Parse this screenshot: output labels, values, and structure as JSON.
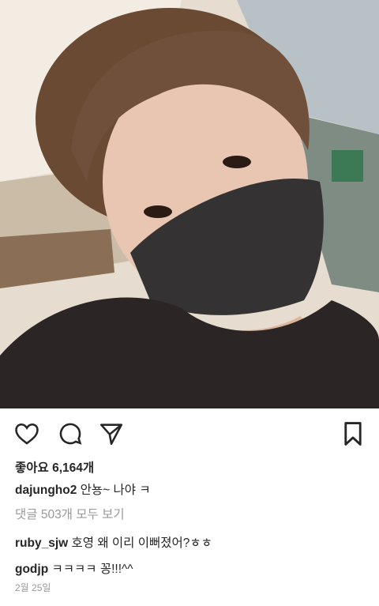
{
  "post": {
    "likes_text": "좋아요 6,164개",
    "caption": {
      "username": "dajungho2",
      "text": "안뇽~ 나야 ㅋ"
    },
    "view_all_comments": "댓글 503개 모두 보기",
    "comments": [
      {
        "username": "ruby_sjw",
        "text": "호영 왜 이리 이뻐졌어?ㅎㅎ"
      },
      {
        "username": "godjp",
        "text": "ㅋㅋㅋㅋ 꽁!!!^^"
      }
    ],
    "date": "2월 25일"
  },
  "icons": {
    "like": "heart-icon",
    "comment": "comment-bubble-icon",
    "share": "paper-plane-icon",
    "save": "bookmark-icon"
  }
}
